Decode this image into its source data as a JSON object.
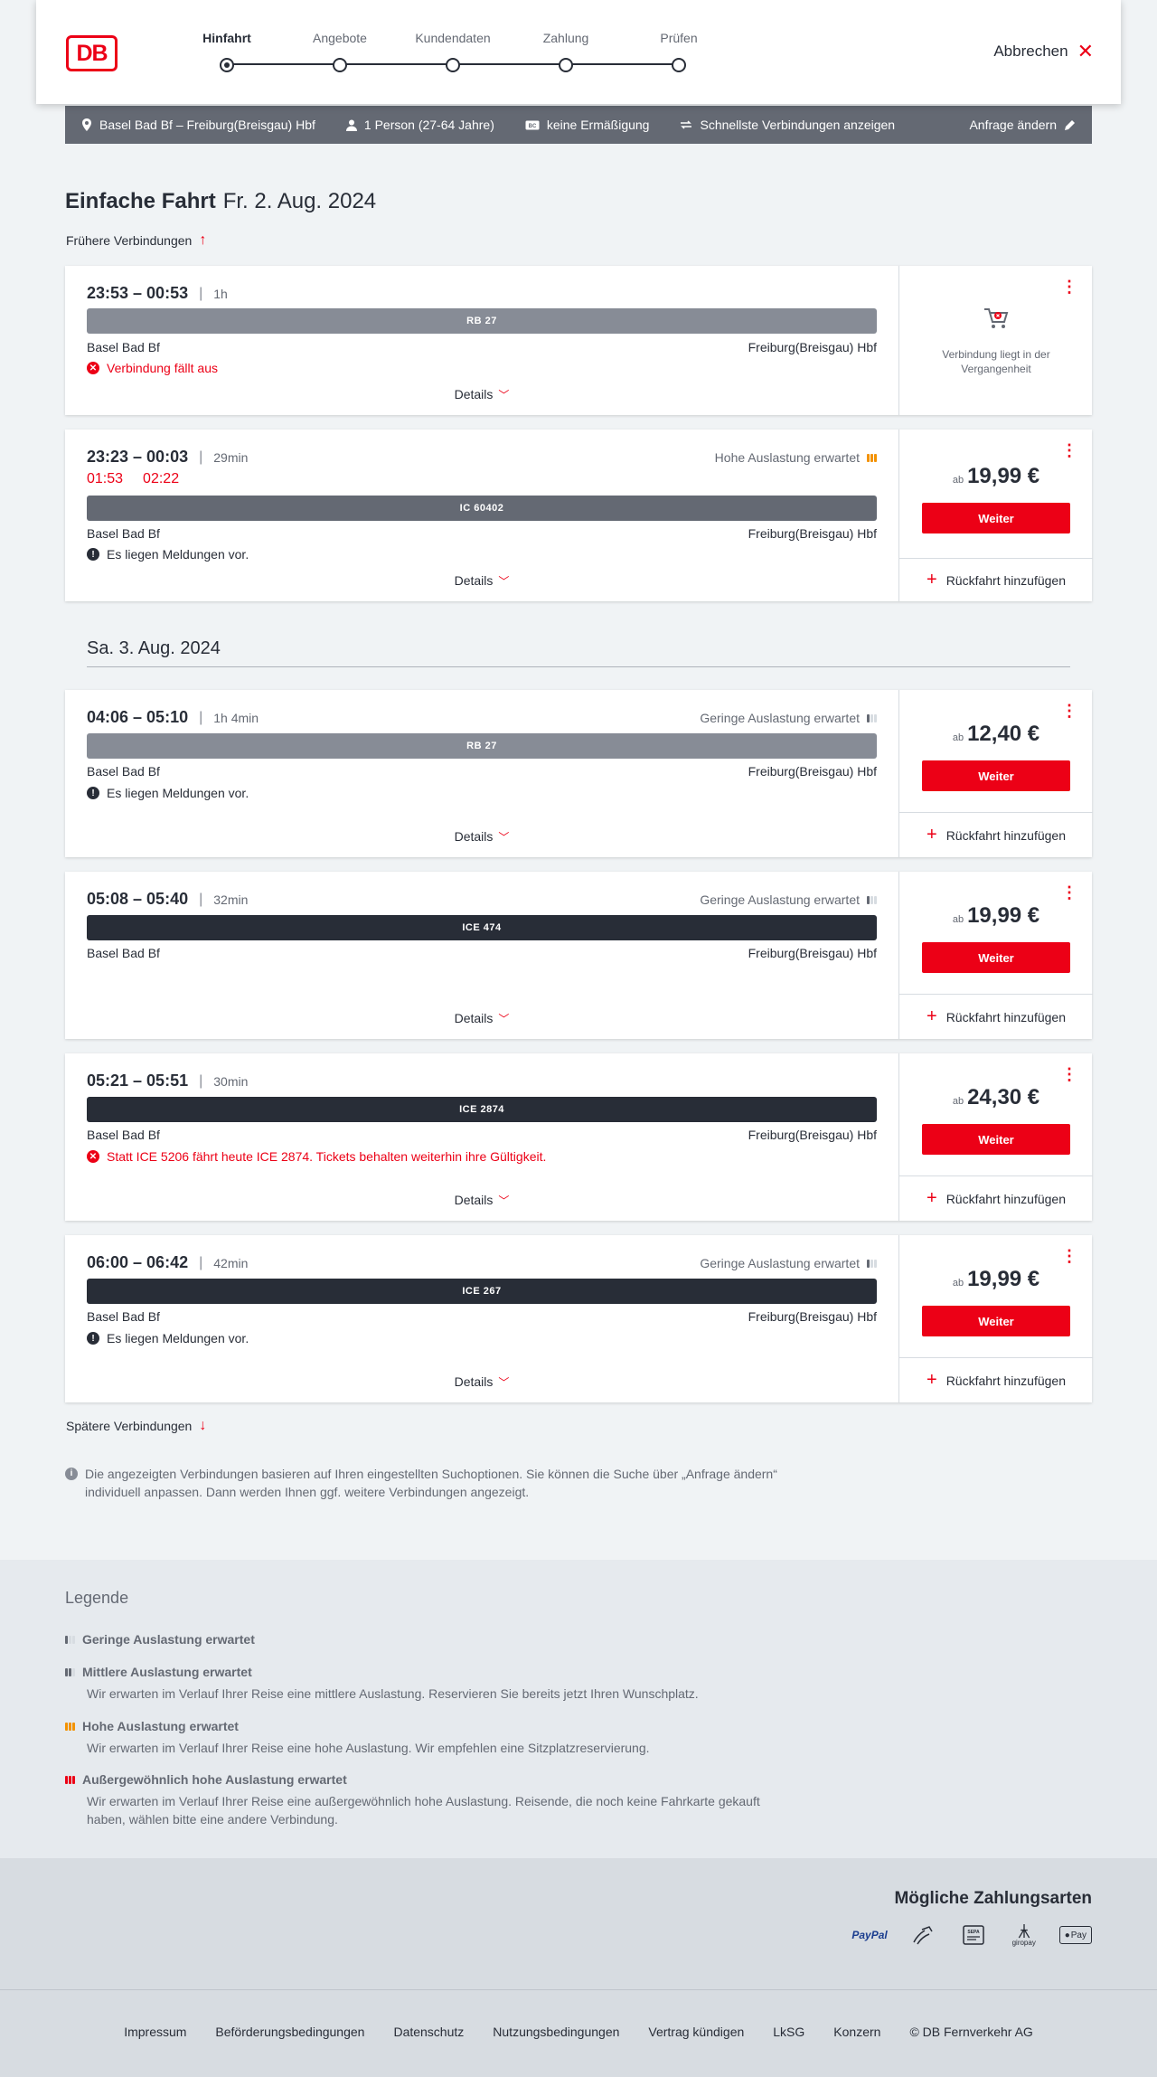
{
  "header": {
    "logo": "DB",
    "steps": [
      "Hinfahrt",
      "Angebote",
      "Kundendaten",
      "Zahlung",
      "Prüfen"
    ],
    "active_step": 0,
    "cancel_label": "Abbrechen"
  },
  "search": {
    "route": "Basel Bad Bf – Freiburg(Breisgau) Hbf",
    "passengers": "1 Person (27-64 Jahre)",
    "discount": "keine Ermäßigung",
    "option": "Schnellste Verbindungen anzeigen",
    "edit_label": "Anfrage ändern"
  },
  "page": {
    "title": "Einfache Fahrt",
    "date": "Fr. 2. Aug. 2024",
    "earlier_label": "Frühere Verbindungen",
    "later_label": "Spätere Verbindungen",
    "day_separator": "Sa. 3. Aug. 2024",
    "details_label": "Details",
    "weiter_label": "Weiter",
    "rueckfahrt_label": "Rückfahrt hinzufügen",
    "ab_label": "ab",
    "note": "Die angezeigten Verbindungen basieren auf Ihren eingestellten Suchoptionen. Sie können die Suche über „Anfrage ändern“ individuell anpassen. Dann werden Ihnen ggf. weitere Verbindungen angezeigt."
  },
  "connections": [
    {
      "times": "23:53 – 00:53",
      "duration": "1h",
      "load": "",
      "train": "RB 27",
      "type": "rb",
      "from": "Basel Bad Bf",
      "to": "Freiburg(Breisgau) Hbf",
      "message": "Verbindung fällt aus",
      "message_type": "red",
      "past_label": "Verbindung liegt in der Vergangenheit"
    },
    {
      "times": "23:23 – 00:03",
      "duration": "29min",
      "delay_dep": "01:53",
      "delay_arr": "02:22",
      "load": "Hohe Auslastung erwartet",
      "train": "IC 60402",
      "type": "ic",
      "from": "Basel Bad Bf",
      "to": "Freiburg(Breisgau) Hbf",
      "message": "Es liegen Meldungen vor.",
      "message_type": "info",
      "price": "19,99 €"
    },
    {
      "times": "04:06 – 05:10",
      "duration": "1h 4min",
      "load": "Geringe Auslastung erwartet",
      "train": "RB 27",
      "type": "rb",
      "from": "Basel Bad Bf",
      "to": "Freiburg(Breisgau) Hbf",
      "message": "Es liegen Meldungen vor.",
      "message_type": "info",
      "price": "12,40 €"
    },
    {
      "times": "05:08 – 05:40",
      "duration": "32min",
      "load": "Geringe Auslastung erwartet",
      "train": "ICE 474",
      "type": "ice",
      "from": "Basel Bad Bf",
      "to": "Freiburg(Breisgau) Hbf",
      "message": "",
      "price": "19,99 €"
    },
    {
      "times": "05:21 – 05:51",
      "duration": "30min",
      "load": "",
      "train": "ICE 2874",
      "type": "ice",
      "from": "Basel Bad Bf",
      "to": "Freiburg(Breisgau) Hbf",
      "message": "Statt ICE 5206 fährt heute ICE 2874. Tickets behalten weiterhin ihre Gültigkeit.",
      "message_type": "red",
      "price": "24,30 €"
    },
    {
      "times": "06:00 – 06:42",
      "duration": "42min",
      "load": "Geringe Auslastung erwartet",
      "train": "ICE 267",
      "type": "ice",
      "from": "Basel Bad Bf",
      "to": "Freiburg(Breisgau) Hbf",
      "message": "Es liegen Meldungen vor.",
      "message_type": "info",
      "price": "19,99 €"
    }
  ],
  "legend": {
    "title": "Legende",
    "items": [
      {
        "title": "Geringe Auslastung erwartet",
        "desc": "",
        "color": "#282d37",
        "level": 1
      },
      {
        "title": "Mittlere Auslastung erwartet",
        "desc": "Wir erwarten im Verlauf Ihrer Reise eine mittlere Auslastung. Reservieren Sie bereits jetzt Ihren Wunschplatz.",
        "color": "#282d37",
        "level": 2
      },
      {
        "title": "Hohe Auslastung erwartet",
        "desc": "Wir erwarten im Verlauf Ihrer Reise eine hohe Auslastung. Wir empfehlen eine Sitzplatzreservierung.",
        "color": "#f39200",
        "level": 3
      },
      {
        "title": "Außergewöhnlich hohe Auslastung erwartet",
        "desc": "Wir erwarten im Verlauf Ihrer Reise eine außergewöhnlich hohe Auslastung. Reisende, die noch keine Fahrkarte gekauft haben, wählen bitte eine andere Verbindung.",
        "color": "#ec0016",
        "level": 4
      }
    ]
  },
  "payment": {
    "title": "Mögliche Zahlungsarten",
    "methods": [
      "PayPal",
      "SEPA",
      "giropay",
      "Pay"
    ]
  },
  "footer": {
    "links": [
      "Impressum",
      "Beförderungsbedingungen",
      "Datenschutz",
      "Nutzungsbedingungen",
      "Vertrag kündigen",
      "LkSG",
      "Konzern",
      "© DB Fernverkehr AG"
    ]
  },
  "colors": {
    "brand": "#ec0016",
    "dark": "#282d37",
    "high_load": "#f39200"
  }
}
